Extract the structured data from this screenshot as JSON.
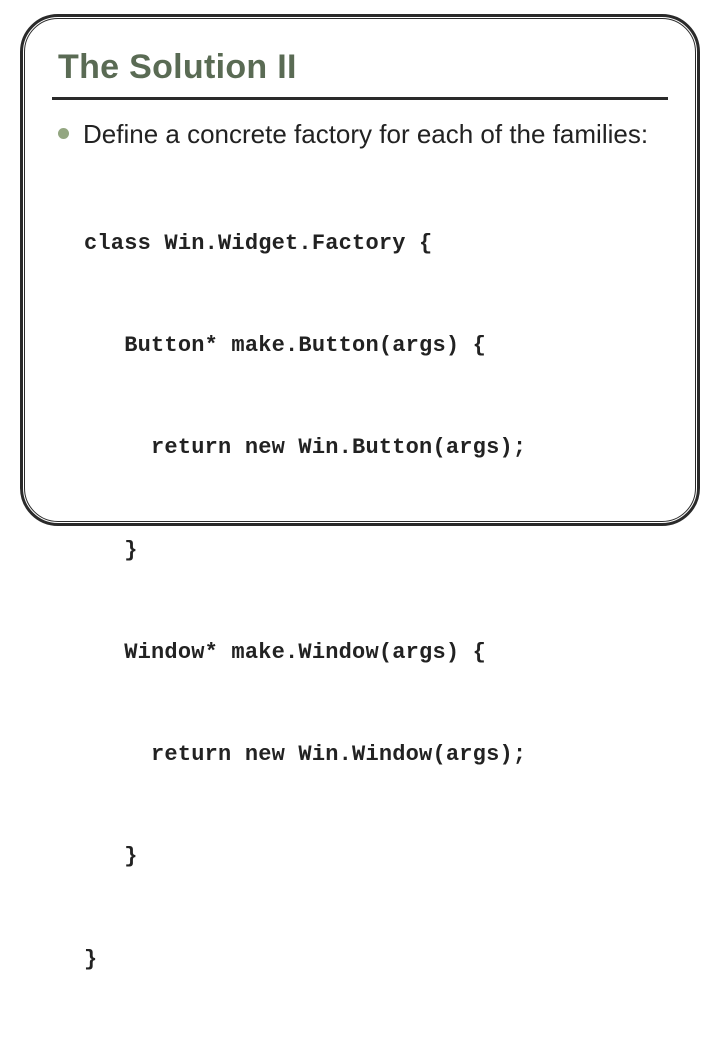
{
  "title": "The Solution II",
  "bullet": {
    "text": "Define a concrete factory for each of the families:"
  },
  "code_lines": [
    "class Win.Widget.Factory {",
    "   Button* make.Button(args) {",
    "     return new Win.Button(args);",
    "   }",
    "   Window* make.Window(args) {",
    "     return new Win.Window(args);",
    "   }",
    "}"
  ]
}
